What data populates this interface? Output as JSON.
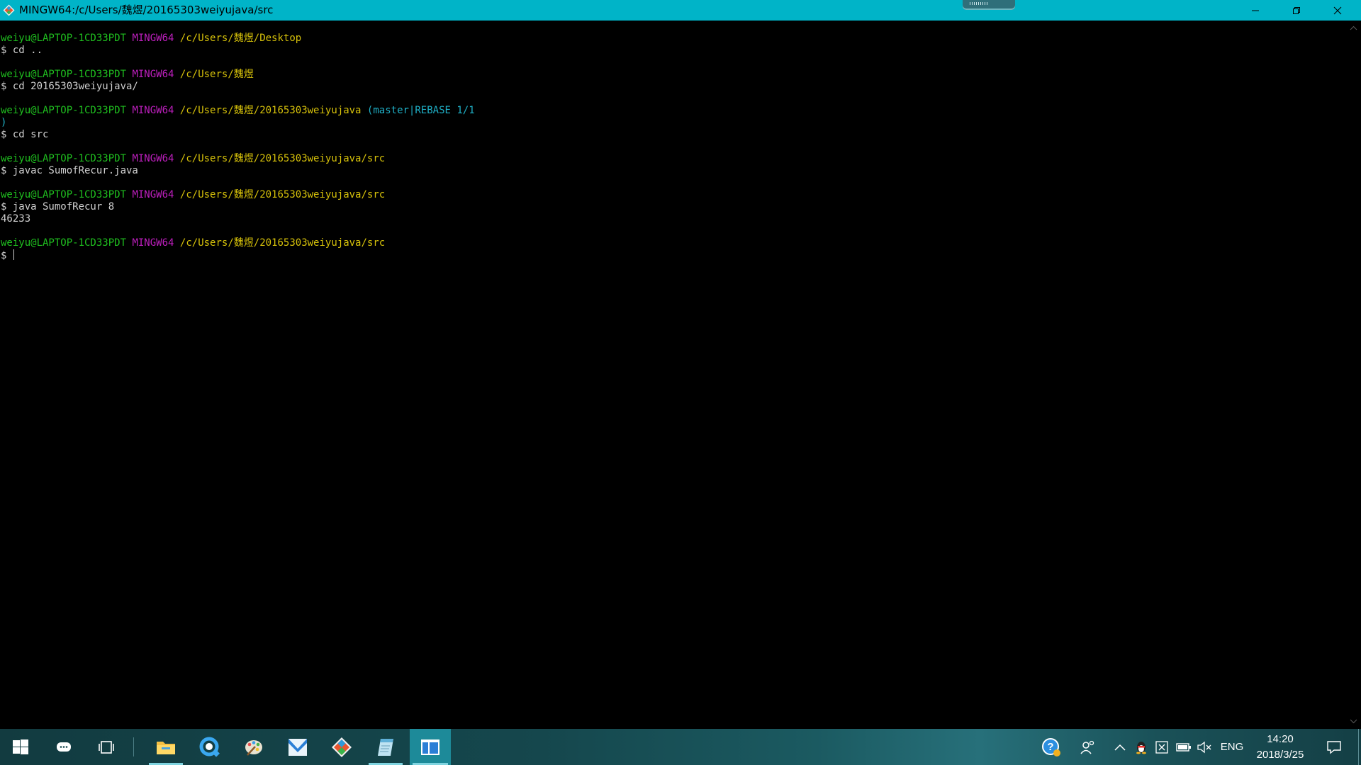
{
  "window": {
    "title": "MINGW64:/c/Users/魏煜/20165303weiyujava/src",
    "icon": "git-bash-icon"
  },
  "terminal": {
    "lines": [
      {
        "kind": "prompt",
        "user": "weiyu@LAPTOP-1CD33PDT",
        "host": "MINGW64",
        "path": "/c/Users/魏煜/Desktop",
        "branch": ""
      },
      {
        "kind": "command",
        "text": "$ cd .."
      },
      {
        "kind": "blank"
      },
      {
        "kind": "prompt",
        "user": "weiyu@LAPTOP-1CD33PDT",
        "host": "MINGW64",
        "path": "/c/Users/魏煜",
        "branch": ""
      },
      {
        "kind": "command",
        "text": "$ cd 20165303weiyujava/"
      },
      {
        "kind": "blank"
      },
      {
        "kind": "prompt",
        "user": "weiyu@LAPTOP-1CD33PDT",
        "host": "MINGW64",
        "path": "/c/Users/魏煜/20165303weiyujava",
        "branch": "(master|REBASE 1/1"
      },
      {
        "kind": "branch-cont",
        "text": ")"
      },
      {
        "kind": "command",
        "text": "$ cd src"
      },
      {
        "kind": "blank"
      },
      {
        "kind": "prompt",
        "user": "weiyu@LAPTOP-1CD33PDT",
        "host": "MINGW64",
        "path": "/c/Users/魏煜/20165303weiyujava/src",
        "branch": ""
      },
      {
        "kind": "command",
        "text": "$ javac SumofRecur.java"
      },
      {
        "kind": "blank"
      },
      {
        "kind": "prompt",
        "user": "weiyu@LAPTOP-1CD33PDT",
        "host": "MINGW64",
        "path": "/c/Users/魏煜/20165303weiyujava/src",
        "branch": ""
      },
      {
        "kind": "command",
        "text": "$ java SumofRecur 8"
      },
      {
        "kind": "output",
        "text": "46233"
      },
      {
        "kind": "blank"
      },
      {
        "kind": "prompt",
        "user": "weiyu@LAPTOP-1CD33PDT",
        "host": "MINGW64",
        "path": "/c/Users/魏煜/20165303weiyujava/src",
        "branch": ""
      },
      {
        "kind": "input",
        "text": "$ "
      }
    ]
  },
  "taskbar": {
    "apps": [
      {
        "name": "file-explorer",
        "running": true
      },
      {
        "name": "browser",
        "running": false
      },
      {
        "name": "paint",
        "running": false
      },
      {
        "name": "mail",
        "running": false
      },
      {
        "name": "git-gui",
        "running": false
      },
      {
        "name": "notepad",
        "running": true
      },
      {
        "name": "git-bash-terminal",
        "running": true,
        "active": true
      }
    ],
    "tray": {
      "language": "ENG",
      "time": "14:20",
      "date": "2018/3/25"
    }
  },
  "colors": {
    "titlebar": "#00b4c8",
    "prompt_user": "#1fbf1f",
    "prompt_host": "#bf1fbf",
    "prompt_path": "#d7c20a",
    "prompt_branch": "#1fb0c7",
    "text": "#d0d0d0"
  }
}
